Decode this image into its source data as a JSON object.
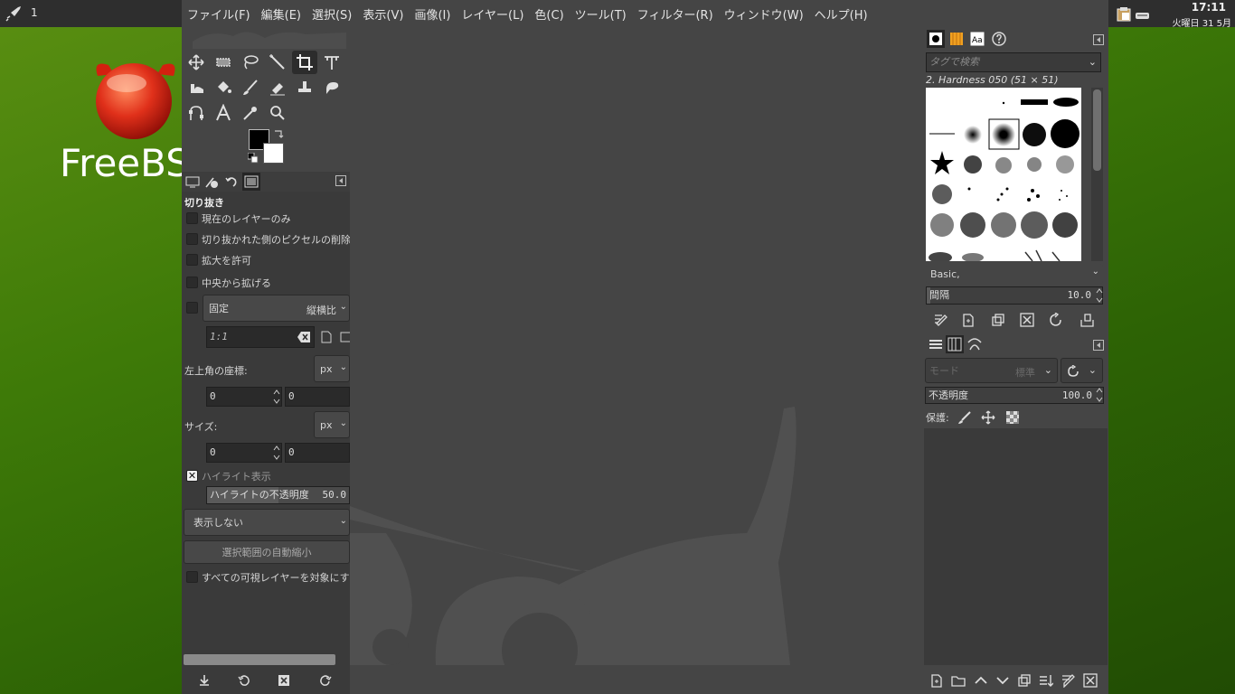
{
  "desktop": {
    "workspace_number": "1",
    "clock": "17:11",
    "date": "火曜日 31 5月",
    "logo_text": "FreeBSD"
  },
  "menu": {
    "items": [
      "ファイル(F)",
      "編集(E)",
      "選択(S)",
      "表示(V)",
      "画像(I)",
      "レイヤー(L)",
      "色(C)",
      "ツール(T)",
      "フィルター(R)",
      "ウィンドウ(W)",
      "ヘルプ(H)"
    ]
  },
  "tool_options": {
    "title": "切り抜き",
    "current_layer_only": "現在のレイヤーのみ",
    "delete_cropped_pixels": "切り抜かれた側のピクセルの削除",
    "allow_growing": "拡大を許可",
    "expand_from_center": "中央から拡げる",
    "fixed": "固定",
    "fixed_mode": "縦横比",
    "ratio_value": "1:1",
    "position_label": "左上角の座標:",
    "position_unit": "px",
    "position_x": "0",
    "position_y": "0",
    "size_label": "サイズ:",
    "size_unit": "px",
    "size_w": "0",
    "size_h": "0",
    "highlight": "ハイライト表示",
    "highlight_opacity_label": "ハイライトの不透明度",
    "highlight_opacity_value": "50.0",
    "guides": "表示しない",
    "auto_shrink": "選択範囲の自動縮小",
    "shrink_merged": "すべての可視レイヤーを対象にする"
  },
  "brushes": {
    "search_placeholder": "タグで検索",
    "current_brush": "2. Hardness 050 (51 × 51)",
    "preset": "Basic,",
    "spacing_label": "間隔",
    "spacing_value": "10.0"
  },
  "layers": {
    "mode_label": "モード",
    "mode_value": "標準",
    "opacity_label": "不透明度",
    "opacity_value": "100.0",
    "lock_label": "保護:"
  },
  "colors": {
    "foreground": "#000000",
    "background": "#ffffff",
    "desktop_green": "#3e7a08"
  }
}
